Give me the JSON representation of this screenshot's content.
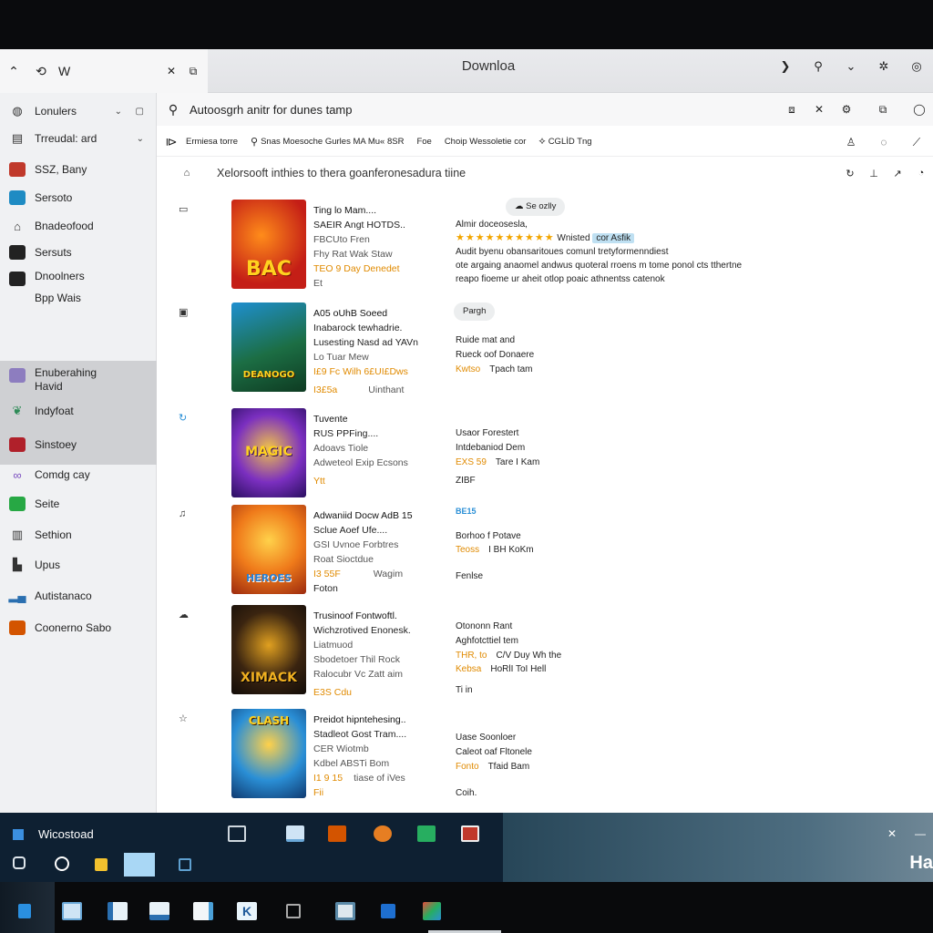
{
  "window": {
    "title": "Downloa",
    "left_label": "W"
  },
  "sidebar": {
    "items": [
      {
        "label": "Lonulers",
        "icon": "globe-icon",
        "color": "#666666"
      },
      {
        "label": "Trreudal: ard",
        "icon": "monitor-icon",
        "color": "#333333"
      },
      {
        "label": "SSZ, Bany",
        "icon": "game-icon",
        "color": "#c0392b"
      },
      {
        "label": "Sersoto",
        "icon": "app-icon",
        "color": "#1e8bc3"
      },
      {
        "label": "Bnadeofood",
        "icon": "home-icon",
        "color": "#555555"
      },
      {
        "label": "Sersuts",
        "icon": "app-icon",
        "color": "#222222"
      },
      {
        "label": "Dnoolners",
        "sub": "Bpp Wais",
        "icon": "app-icon",
        "color": "#222222"
      },
      {
        "label": "Enuberahing",
        "sub": "Havid",
        "icon": "app-icon",
        "color": "#7b5ea7"
      },
      {
        "label": "Indyfoat",
        "icon": "leaf-icon",
        "color": "#2e8b57"
      },
      {
        "label": "Sinstoey",
        "icon": "app-icon",
        "color": "#c0392b"
      },
      {
        "label": "Comdg cay",
        "icon": "link-icon",
        "color": "#7a4dbf"
      },
      {
        "label": "Seite",
        "icon": "app-icon",
        "color": "#27a844"
      },
      {
        "label": "Sethion",
        "icon": "bars-icon",
        "color": "#333333"
      },
      {
        "label": "Upus",
        "icon": "chart-icon",
        "color": "#333333"
      },
      {
        "label": "Autistanaco",
        "icon": "chart-icon",
        "color": "#2a6fb0"
      },
      {
        "label": "Coonerno Sabo",
        "icon": "app-icon",
        "color": "#d35400"
      }
    ]
  },
  "search": {
    "text": "Autoosgrh anitr for dunes tamp"
  },
  "filters": [
    {
      "label": "Ermiesa torre",
      "icon": ""
    },
    {
      "label": "Snas Moesoche Gurles MA Mu« 8SR",
      "icon": "search-icon"
    },
    {
      "label": "Foe",
      "icon": ""
    },
    {
      "label": "Choip Wessoletie cor",
      "icon": ""
    },
    {
      "label": "CGLİD Tng",
      "icon": "tag-icon"
    }
  ],
  "headline": "Xelorsooft inthies to thera goanferonesadura tiine",
  "rows": [
    {
      "title": "Ting lo Mam....",
      "l2": "SAEIR Angt HOTDS..",
      "l3": "FBCUto Fren",
      "l4": "Fhy Rat Wak Staw",
      "l5": "TEO 9 Day Denedet",
      "l6": "Et",
      "badge": "Se ozlly",
      "c1": "Almir doceosesla,",
      "c2_stars": "★★★★★★★★★★",
      "c2_text": "Wnisted",
      "c2_chip": "cor Asfik",
      "c3": "Audit byenu obansaritoues comunl tretyformenndiest",
      "c4": "ote argaing anaomel andwus quoteral rroens m tome ponol cts tthertne",
      "c5": "reapo fioeme ur aheit otlop poaic athnentss catenok",
      "cover": {
        "bg": "#d0261d",
        "text": "BAC",
        "tc": "#ffd21f"
      }
    },
    {
      "title": "A05 oUhB Soeed",
      "l2": "Inabarock tewhadrie.",
      "l3": "Lusesting Nasd ad YAVn",
      "l4": "Lo Tuar Mew",
      "l5": "I£9 Fc  Wilh 6£UI£Dws",
      "l6": "I3£5a",
      "l6b": "Uinthant",
      "badge": "Pargh",
      "c1": "Ruide mat and",
      "c2": "Rueck oof Donaere",
      "c3a": "Kwtso",
      "c3b": "Tpach tam",
      "cover": {
        "bg": "#1d7a4f",
        "text": "DEANOGO",
        "tc": "#ffd21f"
      }
    },
    {
      "title": "Tuvente",
      "l2": "RUS PPFing....",
      "l3": "Adoavs Tiole",
      "l4": "Adweteol Exip Ecsons",
      "l5": "Ytt",
      "c1": "Usaor Forestert",
      "c2": "Intdebaniod Dem",
      "c3a": "EXS 59",
      "c3b": "Tare I Kam",
      "c4": "ZIBF",
      "cover": {
        "bg": "#6a2fb8",
        "text": "MAGIC",
        "tc": "#ffd21f"
      }
    },
    {
      "title": "Adwaniid Docw AdB 15",
      "l2": "Sclue Aoef Ufe....",
      "l3": "GSI Uvnoe Forbtres",
      "l4": "Roat Sioctdue",
      "l5": "I3 55F",
      "l5b": "Wagim",
      "l6": "Foton",
      "tag": "BE15",
      "c1": "Borhoo f Potave",
      "c2a": "Teoss",
      "c2b": "I BH KoKm",
      "c3": "Fenlse",
      "cover": {
        "bg": "#e07a1a",
        "text": "HEROES",
        "tc": "#ffe14a"
      }
    },
    {
      "title": "Trusinoof Fontwoftl.",
      "l2": "Wichzrotived Enonesk.",
      "l3": "Liatmuod",
      "l4": "Sbodetoer Thil Rock",
      "l5": "Ralocubr Vc Zatt aim",
      "l6": "E3S Cdu",
      "c1": "Otononn Rant",
      "c2": "Aghfotcttiel tem",
      "c3a": "THR, to",
      "c3b": "C/V Duy Wh the",
      "c4a": "Kebsa",
      "c4b": "HoRlI ToI Hell",
      "c5": "Ti in",
      "cover": {
        "bg": "#1a1410",
        "text": "XIMACK",
        "tc": "#f0b020"
      }
    },
    {
      "title": "Preidot hipntehesing..",
      "l2": "Stadleot Gost Tram....",
      "l3": "CER Wiotmb",
      "l4": "Kdbel ABSTi Bom",
      "l5": "I1 9 15",
      "l5b": "tiase of iVes",
      "l6": "Fii",
      "c1": "Uase Soonloer",
      "c2": "Caleot oaf Fltonele",
      "c3a": "Fonto",
      "c3b": "Tfaid Bam",
      "c4": "Coih.",
      "cover": {
        "bg": "#2a8fd6",
        "text": "CLASH",
        "tc": "#ffd21f"
      }
    }
  ],
  "taskbar": {
    "title": "Wicostoad",
    "right_text": "Ha"
  }
}
